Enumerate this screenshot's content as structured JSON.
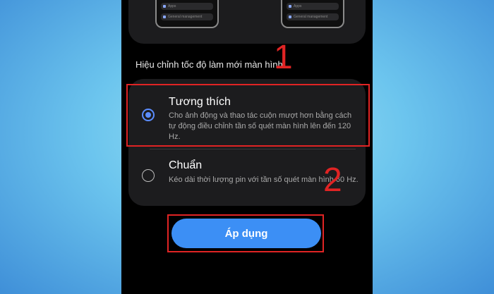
{
  "previews": {
    "left": {
      "row1": "Apps",
      "row2": "General management"
    },
    "right": {
      "row1": "Apps",
      "row2": "General management"
    }
  },
  "section": {
    "caption": "Hiệu chỉnh tốc độ làm mới màn hình."
  },
  "options": [
    {
      "title": "Tương thích",
      "description": "Cho ảnh động và thao tác cuộn mượt hơn bằng cách tự động điều chỉnh tần số quét màn hình lên đến 120 Hz.",
      "selected": true
    },
    {
      "title": "Chuẩn",
      "description": "Kéo dài thời lượng pin với tần số quét màn hình 60 Hz.",
      "selected": false
    }
  ],
  "apply_button": {
    "label": "Áp dụng"
  },
  "annotations": {
    "step1": "1",
    "step2": "2",
    "color": "#e02424"
  },
  "colors": {
    "accent": "#3c8ff5",
    "radio": "#5b8dff",
    "background": "#000000",
    "card": "#1c1c1e"
  }
}
